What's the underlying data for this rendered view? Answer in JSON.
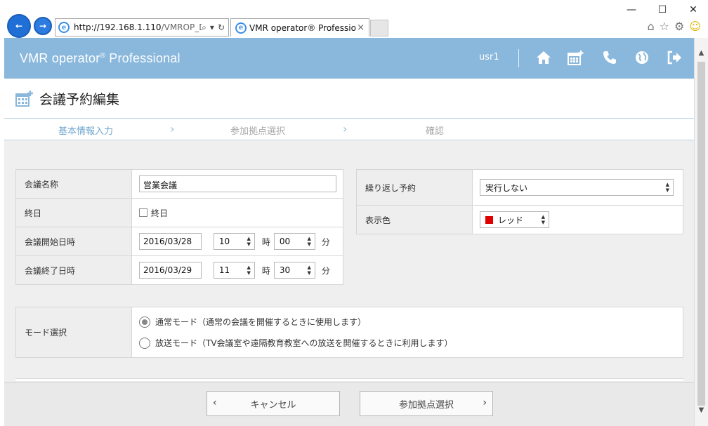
{
  "browser": {
    "url_host": "http://192.168.1.110",
    "url_path": "/VMROP_De",
    "tab_title": "VMR operator® Professional",
    "tab_close": "×"
  },
  "app": {
    "title_main": "VMR operator",
    "title_reg": "®",
    "title_sub": "Professional",
    "user": "usr1",
    "header_icons": [
      "home-icon",
      "calendar-add-icon",
      "phone-icon",
      "globe-icon",
      "sign-out-icon"
    ]
  },
  "page": {
    "title": "会議予約編集"
  },
  "steps": [
    {
      "label": "基本情報入力",
      "state": "active"
    },
    {
      "label": "参加拠点選択",
      "state": "inactive"
    },
    {
      "label": "確認",
      "state": "inactive"
    }
  ],
  "form": {
    "meeting_name": {
      "label": "会議名称",
      "value": "営業会議"
    },
    "all_day": {
      "label": "終日",
      "checkbox_label": "終日",
      "checked": false
    },
    "start": {
      "label": "会議開始日時",
      "date": "2016/03/28",
      "hour": "10",
      "minute": "00",
      "hour_unit": "時",
      "minute_unit": "分"
    },
    "end": {
      "label": "会議終了日時",
      "date": "2016/03/29",
      "hour": "11",
      "minute": "30",
      "hour_unit": "時",
      "minute_unit": "分"
    },
    "repeat": {
      "label": "繰り返し予約",
      "value": "実行しない"
    },
    "color": {
      "label": "表示色",
      "value": "レッド",
      "swatch": "#e00000"
    },
    "mode": {
      "label": "モード選択",
      "options": [
        {
          "label": "通常モード（通常の会議を開催するときに使用します）",
          "selected": true
        },
        {
          "label": "放送モード（TV会議室や遠隔教育教室への放送を開催するときに利用します）",
          "selected": false
        }
      ]
    }
  },
  "buttons": {
    "cancel": "キャンセル",
    "next": "参加拠点選択"
  },
  "colors": {
    "header_bg": "#8ab8dc",
    "step_active": "#6fa5cf",
    "label_bg": "#eeeeee"
  }
}
